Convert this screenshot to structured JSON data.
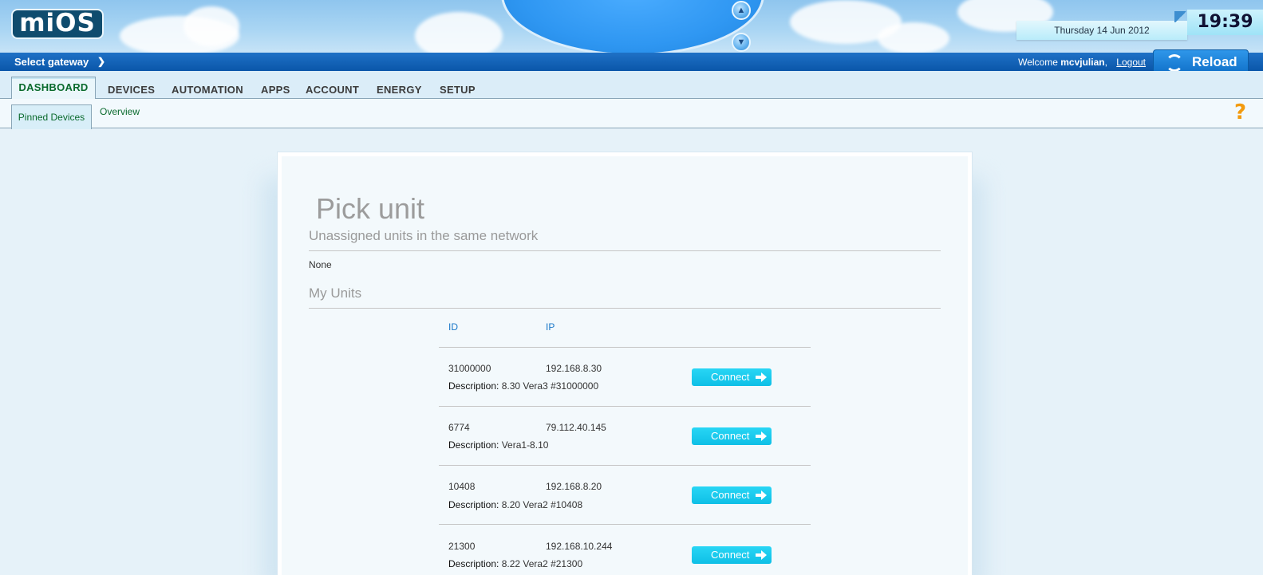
{
  "header": {
    "logo_text": "miOS",
    "date": "Thursday 14 Jun 2012",
    "time": "19:39"
  },
  "bluebar": {
    "select_gateway": "Select gateway",
    "welcome_prefix": "Welcome",
    "username": "mcvjulian",
    "comma": ",",
    "logout": "Logout",
    "reload": "Reload"
  },
  "nav": {
    "tabs": [
      "DASHBOARD",
      "DEVICES",
      "AUTOMATION",
      "APPS",
      "ACCOUNT",
      "ENERGY",
      "SETUP"
    ],
    "active": "DASHBOARD"
  },
  "subnav": {
    "tabs": [
      "Pinned Devices",
      "Overview"
    ],
    "active": "Pinned Devices"
  },
  "help_symbol": "?",
  "panel": {
    "title": "Pick unit",
    "unassigned_heading": "Unassigned units in the same network",
    "unassigned_value": "None",
    "my_units_heading": "My Units",
    "columns": {
      "id": "ID",
      "ip": "IP"
    },
    "description_label": "Description:",
    "connect_label": "Connect",
    "units": [
      {
        "id": "31000000",
        "ip": "192.168.8.30",
        "description": "8.30 Vera3 #31000000"
      },
      {
        "id": "6774",
        "ip": "79.112.40.145",
        "description": "Vera1-8.10"
      },
      {
        "id": "10408",
        "ip": "192.168.8.20",
        "description": "8.20 Vera2 #10408"
      },
      {
        "id": "21300",
        "ip": "192.168.10.244",
        "description": "8.22 Vera2 #21300"
      }
    ]
  },
  "colors": {
    "brand_blue": "#0a56a9",
    "connect_cyan": "#0ebfe6",
    "active_green": "#0a6a2d",
    "help_orange": "#f39a0e"
  },
  "icons": [
    "eject-icon",
    "chevron-down-icon",
    "reload-icon",
    "help-icon",
    "arrow-right-icon"
  ]
}
